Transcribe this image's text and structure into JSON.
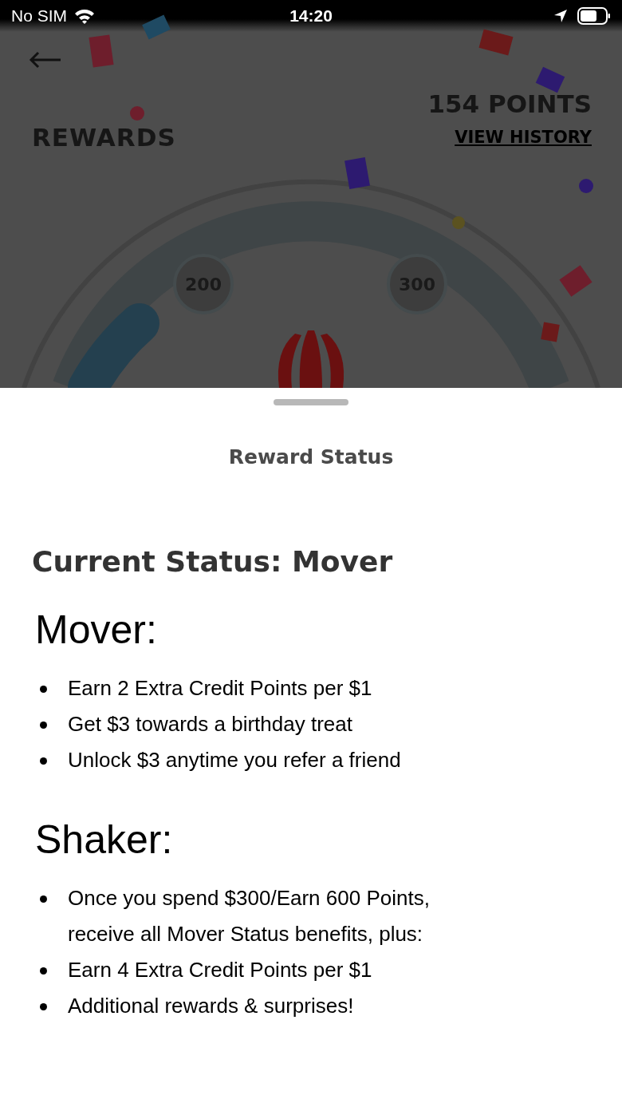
{
  "status_bar": {
    "carrier": "No SIM",
    "time": "14:20"
  },
  "header": {
    "title": "REWARDS",
    "points": "154 POINTS",
    "history_link": "VIEW HISTORY"
  },
  "gauge": {
    "milestones": [
      "200",
      "300"
    ]
  },
  "sheet": {
    "title": "Reward Status",
    "current_status": "Current Status: Mover",
    "tiers": [
      {
        "name": "Mover:",
        "benefits": [
          "Earn 2 Extra Credit Points per $1",
          "Get $3 towards a birthday treat",
          "Unlock $3 anytime you refer a friend"
        ]
      },
      {
        "name": "Shaker:",
        "benefits": [
          "Once you spend $300/Earn 600 Points, receive all Mover Status benefits, plus:",
          "Earn 4 Extra Credit Points per $1",
          "Additional rewards & surprises!"
        ]
      }
    ]
  }
}
